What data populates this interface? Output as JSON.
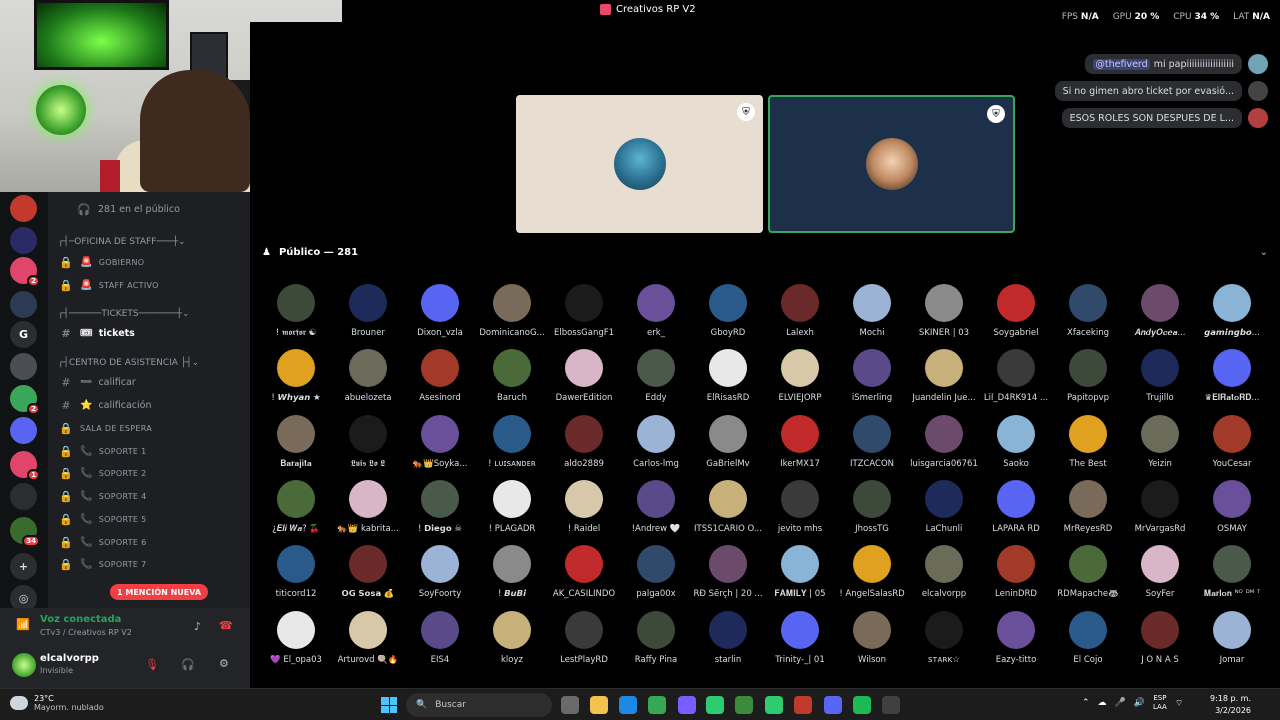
{
  "window": {
    "title": "Creativos RP V2"
  },
  "perf": {
    "fps_label": "FPS",
    "fps": "N/A",
    "gpu_label": "GPU",
    "gpu": "20 %",
    "cpu_label": "CPU",
    "cpu": "34 %",
    "lat_label": "LAT",
    "lat": "N/A"
  },
  "webcam_overlay_num": "2",
  "sidebar": {
    "audience": "281 en el público",
    "items": [
      {
        "text": "┌┤─OFICINA DE STAFF───┼",
        "kind": "category"
      },
      {
        "text": "GOBIERNO",
        "kind": "small",
        "emoji": "🚨"
      },
      {
        "text": "STAFF ACTIVO",
        "kind": "small",
        "emoji": "🚨"
      },
      {
        "text": "┌┤──────TICKETS───────┼",
        "kind": "category"
      },
      {
        "text": "tickets",
        "kind": "active",
        "emoji": "🎟"
      },
      {
        "text": "┌┤CENTRO DE ASISTENCIA ├┤",
        "kind": "category"
      },
      {
        "text": "calificar",
        "kind": "text",
        "emoji": "➖"
      },
      {
        "text": "calificación",
        "kind": "text",
        "emoji": "⭐"
      },
      {
        "text": "SALA DE ESPERA",
        "kind": "small",
        "emoji": ""
      },
      {
        "text": "SOPORTE 1",
        "kind": "small",
        "emoji": "📞"
      },
      {
        "text": "SOPORTE 2",
        "kind": "small",
        "emoji": "📞"
      },
      {
        "text": "SOPORTE 4",
        "kind": "small",
        "emoji": "📞"
      },
      {
        "text": "SOPORTE 5",
        "kind": "small",
        "emoji": "📞"
      },
      {
        "text": "SOPORTE 6",
        "kind": "small",
        "emoji": "📞"
      },
      {
        "text": "SOPORTE 7",
        "kind": "small",
        "emoji": "📞"
      }
    ],
    "mention_pill": "1 MENCIÓN NUEVA"
  },
  "servers": [
    {
      "badge": ""
    },
    {
      "badge": ""
    },
    {
      "badge": "2"
    },
    {
      "badge": ""
    },
    {
      "letter": "G",
      "badge": ""
    },
    {
      "badge": ""
    },
    {
      "badge": "2"
    },
    {
      "badge": ""
    },
    {
      "badge": "1"
    },
    {
      "badge": ""
    },
    {
      "badge": "34"
    }
  ],
  "voice": {
    "status": "Voz conectada",
    "channel": "CTv3 / Creativos RP V2"
  },
  "user": {
    "name": "elcalvorpp",
    "status": "Invisible"
  },
  "chat": [
    {
      "mention": "@thefiverd",
      "text": "mi papiiiiiiiiiiiiiiiiii"
    },
    {
      "mention": "",
      "text": "Si no gimen abro ticket por evasió..."
    },
    {
      "mention": "",
      "text": "ESOS ROLES SON DESPUES DE L..."
    }
  ],
  "public_header": "Público — 281",
  "members": [
    "! 𝖒𝖔𝖗𝖋𝖔𝖗 ☯",
    "Brouner",
    "Dixon_vzla",
    "DominicanoG...",
    "ElbossGangF1",
    "erk_",
    "GboyRD",
    "Lalexh",
    "Mochi",
    "SKINER | 03",
    "Soygabriel",
    "Xfaceking",
    "𝑨𝒏𝒅𝒚𝑶𝒄𝒆𝒂...",
    "𝙜𝙖𝙢𝙞𝙣𝙜𝙗𝙤...",
    "! 𝙒𝙝𝙮𝙖𝙣 ★",
    "abuelozeta",
    "Asesinord",
    "Baruch",
    "DawerEdition",
    "Eddy",
    "ElRisasRD",
    "ELVIEJORP",
    "iSmerling",
    "Juandelin Jue...",
    "Lil_D4RK914 ...",
    "Papitopvp",
    "Trujillo",
    "♛𝐄𝐥𝐑𝐚𝐭𝐨𝐑𝐃...",
    "𝐁𝐚𝐫𝐚𝐣𝐢𝐭𝐚",
    "𝕷𝖚𝖎𝖘 𝕷𝖔 𝕷",
    "🐅👑Soyka...",
    "! ʟᴜɪꜱᴀɴᴅᴇʀ",
    "aldo2889",
    "Carlos-lmg",
    "GaBrielMv",
    "IkerMX17",
    "ITZCACON",
    "luisgarcia06761",
    "Saoko",
    "The Best",
    "Yeizin",
    "YouCesar",
    "¿𝑬𝒍𝒊 𝑾𝒂? 🍒",
    "🐅👑 kabrita...",
    "! 𝗗𝗶𝗲𝗴𝗼 ☠",
    "! PLAGADR",
    "! Raidel",
    "!Andrew 🤍",
    "ITSS1CARIO O...",
    "jevito mhs",
    "JhossTG",
    "LaChunli",
    "LAPARA RD",
    "MrReyesRD",
    "MrVargasRd",
    "OSMAY",
    "titicord12",
    "𝗢𝗚 𝗦𝗼𝘀𝗮 💰",
    "SoyFoorty",
    "! 𝘽𝙪𝘽𝙞",
    "AK_CASILINDO",
    "palga00x",
    "RÐ Šērçĥ | 20 ...",
    "𝐅𝐀𝐌𝐈𝐋𝐘 | 05",
    "! AngelSalasRD",
    "elcalvorpp",
    "LeninDRD",
    "RDMapache🦝",
    "SoyFer",
    "𝐌𝐚𝐫𝐥𝐨𝐧 ᴺᴼ ᴰᴹ ᵀ",
    "💜 El_opa03",
    "Arturovd 🍭🔥",
    "EIS4",
    "kloyz",
    "LestPlayRD",
    "Raffy Pina",
    "starlin",
    "Trinity-_| 01",
    "Wilson",
    "ꜱᴛᴀʀᴋ☆",
    "Eazy-titto",
    "El Cojo",
    "J O N A S",
    "Jomar"
  ],
  "taskbar": {
    "temp": "23°C",
    "weather": "Mayorm. nublado",
    "search_placeholder": "Buscar",
    "lang1": "ESP",
    "lang2": "LAA",
    "time": "9:18 p. m.",
    "date": "3/2/2026"
  },
  "colors": {
    "accent": "#5865f2",
    "online": "#23a55a",
    "danger": "#f23f43"
  }
}
